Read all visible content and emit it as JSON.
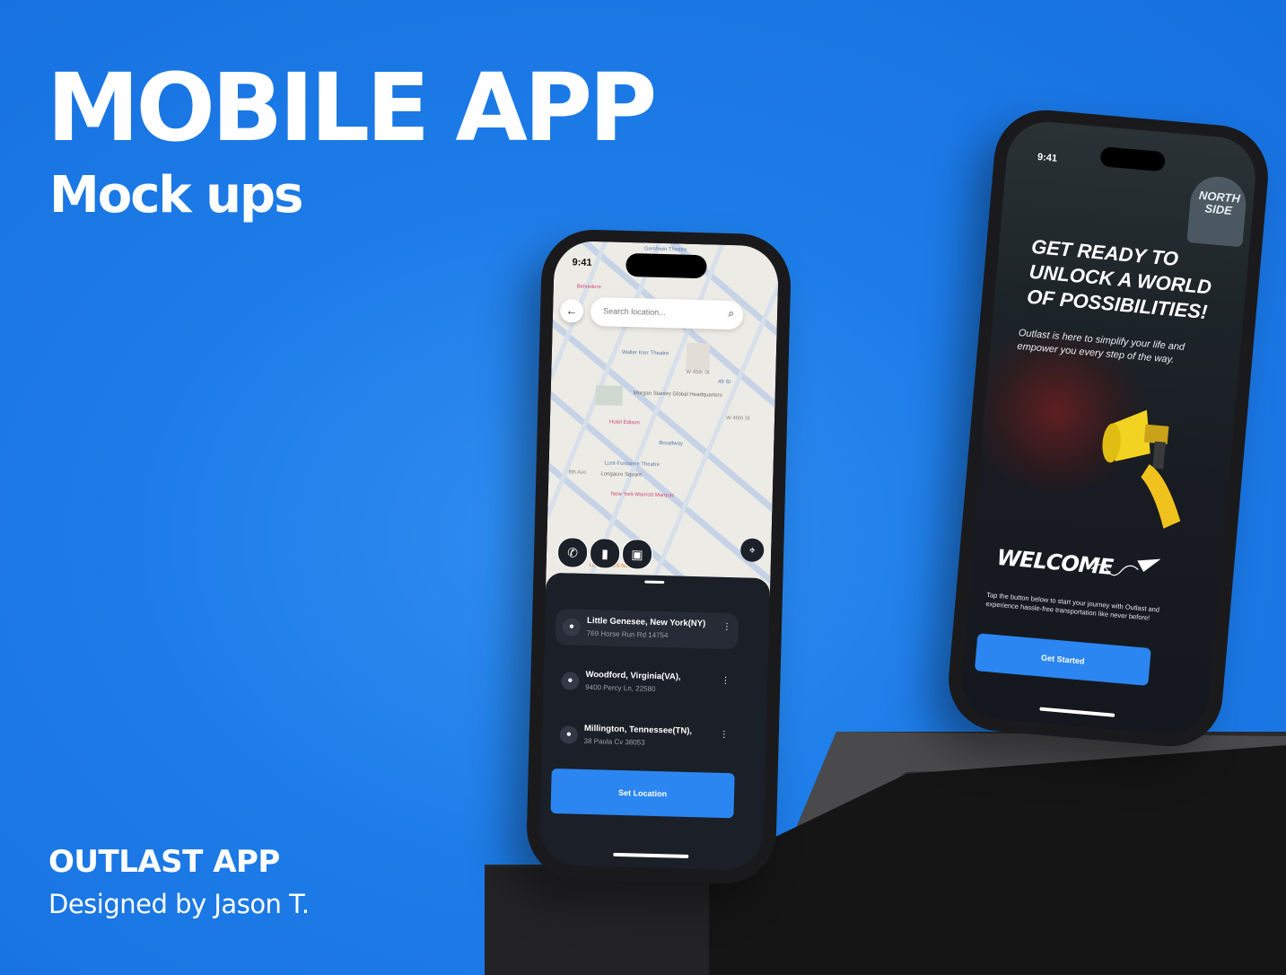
{
  "hero": {
    "title": "MOBILE APP",
    "subtitle": "Mock ups",
    "app_name": "OUTLAST APP",
    "designer": "Designed by Jason T."
  },
  "colors": {
    "background": "#1d7ce8",
    "accent": "#2b86f1",
    "sheet": "#1b1f27"
  },
  "map_screen": {
    "time": "9:41",
    "search_placeholder": "Search location...",
    "map_labels": [
      "Gershwin Theatre",
      "Belvedere",
      "Walter Kerr Theatre",
      "Morgan Stanley Global Headquarters",
      "Hotel Edison",
      "Broadway",
      "Lunt-Fontanne Theatre",
      "Longacre Square",
      "New York Marriott Marquis",
      "LOS TACOS No.1",
      "W 46th St",
      "W 45th St",
      "8th Ave",
      "49 St"
    ],
    "locations": [
      {
        "title": "Little Genesee, New York(NY)",
        "address": "769 Horse Run Rd 14754",
        "active": true
      },
      {
        "title": "Woodford, Virginia(VA),",
        "address": "9400 Percy Ln, 22580",
        "active": false
      },
      {
        "title": "Millington, Tennessee(TN),",
        "address": "38 Paula Cv 38053",
        "active": false
      }
    ],
    "set_location_label": "Set Location",
    "icons": [
      "back-arrow-icon",
      "search-icon",
      "phone-icon",
      "battery-icon",
      "briefcase-icon",
      "crosshair-icon",
      "location-pin-icon",
      "more-vertical-icon"
    ]
  },
  "welcome_screen": {
    "time": "9:41",
    "sign_text": "NORTH SIDE",
    "headline": "GET READY TO UNLOCK A WORLD OF POSSIBILITIES!",
    "tagline": "Outlast is here to simplify your life and empower you every step of the way.",
    "welcome_title": "WELCOME",
    "welcome_body": "Tap the button below to start your journey with Outlast and experience hassle-free transportation like never before!",
    "get_started_label": "Get Started",
    "icons": [
      "megaphone-icon",
      "paper-plane-icon"
    ]
  }
}
